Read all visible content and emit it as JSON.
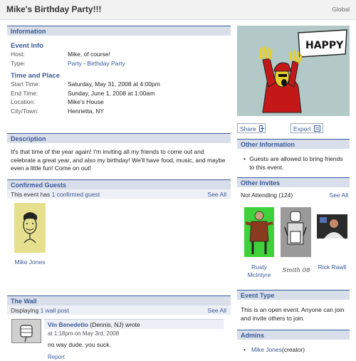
{
  "header": {
    "title": "Mike's Birthday Party!!!",
    "scope": "Global"
  },
  "information": {
    "section_title": "Information",
    "event_info_title": "Event Info",
    "host_label": "Host:",
    "host_value": "Mike, of course!",
    "type_label": "Type:",
    "type_value_1": "Party",
    "type_sep": " - ",
    "type_value_2": "Birthday Party",
    "time_place_title": "Time and Place",
    "start_label": "Start Time:",
    "start_value": "Saturday, May 31, 2008 at 4:00pm",
    "end_label": "End Time:",
    "end_value": "Sunday, June 1, 2008 at 1:00am",
    "location_label": "Location:",
    "location_value": "Mike's House",
    "city_label": "City/Town:",
    "city_value": "Henrietta, NY"
  },
  "description": {
    "section_title": "Description",
    "text": "It's that time of the year again! I'm inviting all my friends to come out and celebrate a great year, and also my birthday! We'll have food, music, and maybe even a little fun! Come on out!"
  },
  "confirmed": {
    "section_title": "Confirmed Guests",
    "summary_prefix": "This event has ",
    "summary_link": "1 confirmed guest",
    "see_all": "See All",
    "guests": [
      {
        "name": "Mike Jones"
      }
    ]
  },
  "wall": {
    "section_title": "The Wall",
    "summary_prefix": "Displaying ",
    "summary_link": "1 wall post",
    "see_all": "See All",
    "post": {
      "author": "Vin Benedetto",
      "meta": " (Dennis, NJ) wrote",
      "time": "at 1:18pm on May 3rd, 2008",
      "body": "no way dude. you suck.",
      "report": "Report"
    }
  },
  "actions": {
    "share": "Share",
    "export": "Export"
  },
  "other_information": {
    "section_title": "Other Information",
    "bullet": "Guests are allowed to bring friends to this event."
  },
  "other_invites": {
    "section_title": "Other Invites",
    "status": "Not Attending (124)",
    "see_all": "See All",
    "people": [
      {
        "name": "Rusty McIntyre"
      },
      {
        "name": "Smith 08"
      },
      {
        "name": "Rick Rawll"
      }
    ]
  },
  "event_type": {
    "section_title": "Event Type",
    "text": "This is an open event. Anyone can join and invite others to join."
  },
  "admins": {
    "section_title": "Admins",
    "name": "Mike Jones",
    "role": " (creator)"
  },
  "poster": {
    "banner_text": "HAPPY"
  }
}
